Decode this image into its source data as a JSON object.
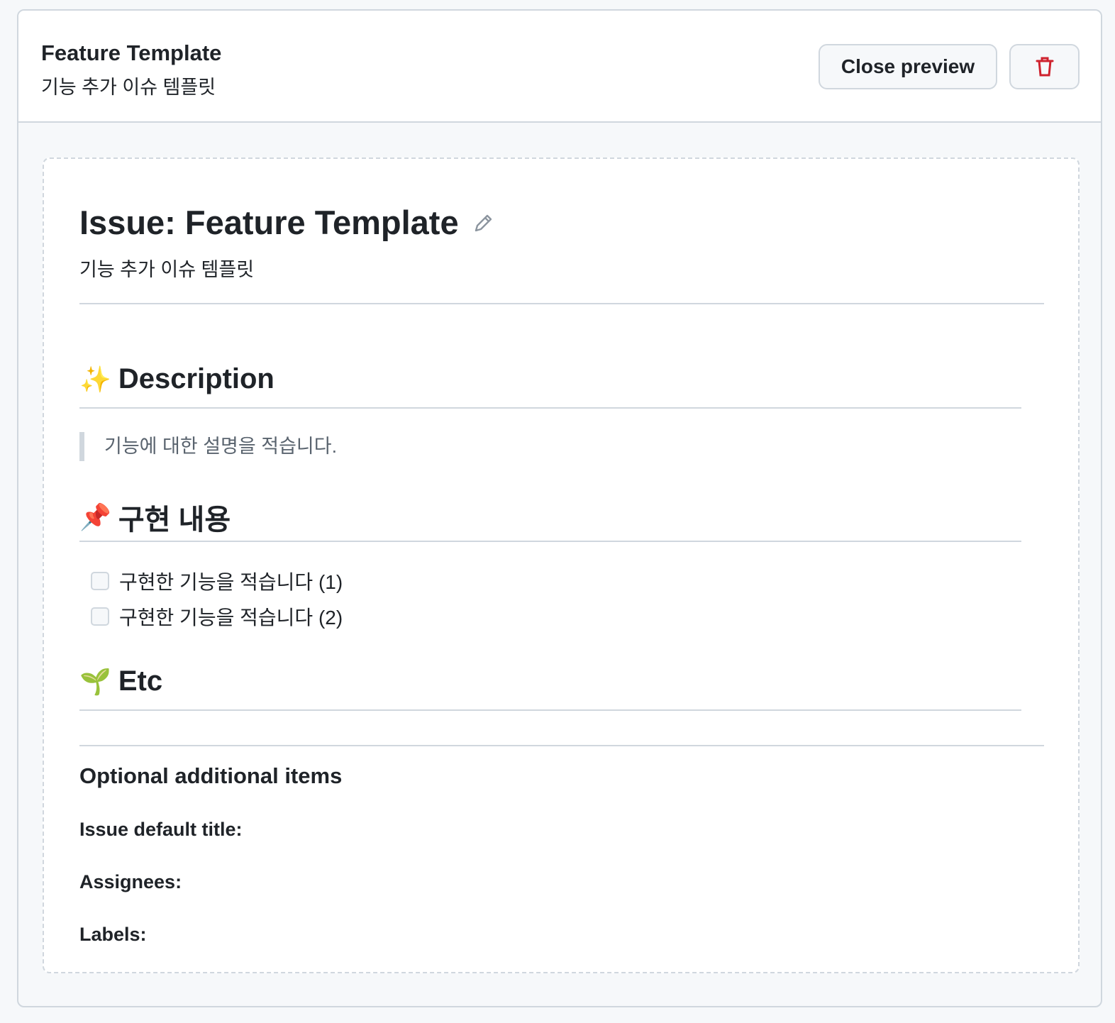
{
  "header": {
    "title": "Feature Template",
    "subtitle": "기능 추가 이슈 템플릿",
    "close_label": "Close preview",
    "delete_icon": "trash-icon"
  },
  "preview": {
    "title": "Issue: Feature Template",
    "subtitle": "기능 추가 이슈 템플릿",
    "sections": [
      {
        "emoji": "✨",
        "heading": "Description"
      },
      {
        "emoji": "📌",
        "heading": "구현 내용"
      },
      {
        "emoji": "🌱",
        "heading": "Etc"
      }
    ],
    "quote": "기능에 대한 설명을 적습니다.",
    "tasks": [
      "구현한 기능을 적습니다 (1)",
      "구현한 기능을 적습니다 (2)"
    ],
    "optional": {
      "heading": "Optional additional items",
      "default_title": "Issue default title:",
      "assignees": "Assignees:",
      "labels": "Labels:"
    }
  },
  "colors": {
    "danger": "#cf222e",
    "border": "#d0d7de"
  }
}
